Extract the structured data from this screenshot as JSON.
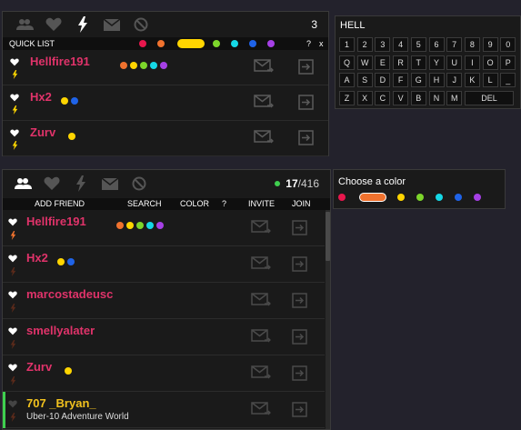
{
  "top_panel": {
    "count": "3",
    "quick_list_label": "QUICK LIST",
    "help_label": "?",
    "close_label": "x",
    "filter_colors": [
      "#e8174d",
      "#f0722e",
      "#ffd500",
      "#7dd62b",
      "#15d8e6",
      "#1f63e8",
      "#a640e6"
    ],
    "selected_color": "#ffd500",
    "rows": [
      {
        "name": "Hellfire191",
        "dots": [
          "#f0722e",
          "#ffd500",
          "#7dd62b",
          "#15d8e6",
          "#a640e6"
        ]
      },
      {
        "name": "Hx2",
        "dots": [
          "#ffd500",
          "#1f63e8"
        ]
      },
      {
        "name": "Zurv",
        "dots": [
          "#ffd500"
        ]
      }
    ]
  },
  "keyboard": {
    "input_value": "HELL",
    "rows": [
      [
        "1",
        "2",
        "3",
        "4",
        "5",
        "6",
        "7",
        "8",
        "9",
        "0"
      ],
      [
        "Q",
        "W",
        "E",
        "R",
        "T",
        "Y",
        "U",
        "I",
        "O",
        "P"
      ],
      [
        "A",
        "S",
        "D",
        "F",
        "G",
        "H",
        "J",
        "K",
        "L",
        "_"
      ],
      [
        "Z",
        "X",
        "C",
        "V",
        "B",
        "N",
        "M"
      ]
    ],
    "del_label": "DEL"
  },
  "main_panel": {
    "online": "17",
    "total": "/416",
    "toolbar": {
      "add_friend": "ADD FRIEND",
      "search": "SEARCH",
      "color": "COLOR",
      "help": "?",
      "invite": "INVITE",
      "join": "JOIN"
    },
    "rows": [
      {
        "name": "Hellfire191",
        "dots": [
          "#f0722e",
          "#ffd500",
          "#7dd62b",
          "#15d8e6",
          "#a640e6"
        ],
        "status": ""
      },
      {
        "name": "Hx2",
        "dots": [
          "#ffd500",
          "#1f63e8"
        ],
        "status": ""
      },
      {
        "name": "marcostadeusc",
        "dots": [],
        "status": ""
      },
      {
        "name": "smellyalater",
        "dots": [],
        "status": ""
      },
      {
        "name": "Zurv",
        "dots": [
          "#ffd500"
        ],
        "status": ""
      },
      {
        "name": "707 _Bryan_",
        "dots": [],
        "status": "Uber-10 Adventure World"
      }
    ]
  },
  "color_picker": {
    "title": "Choose a color",
    "colors": [
      "#e8174d",
      "#f0722e",
      "#ffd500",
      "#7dd62b",
      "#15d8e6",
      "#1f63e8",
      "#a640e6"
    ],
    "selected": "#f0722e"
  },
  "colors": {
    "name_pink": "#e0336a",
    "name_gold": "#f2c21e",
    "online_green": "#3fcf4f",
    "bolt_yellow": "#ffd500",
    "bolt_orange": "#f0722e"
  }
}
